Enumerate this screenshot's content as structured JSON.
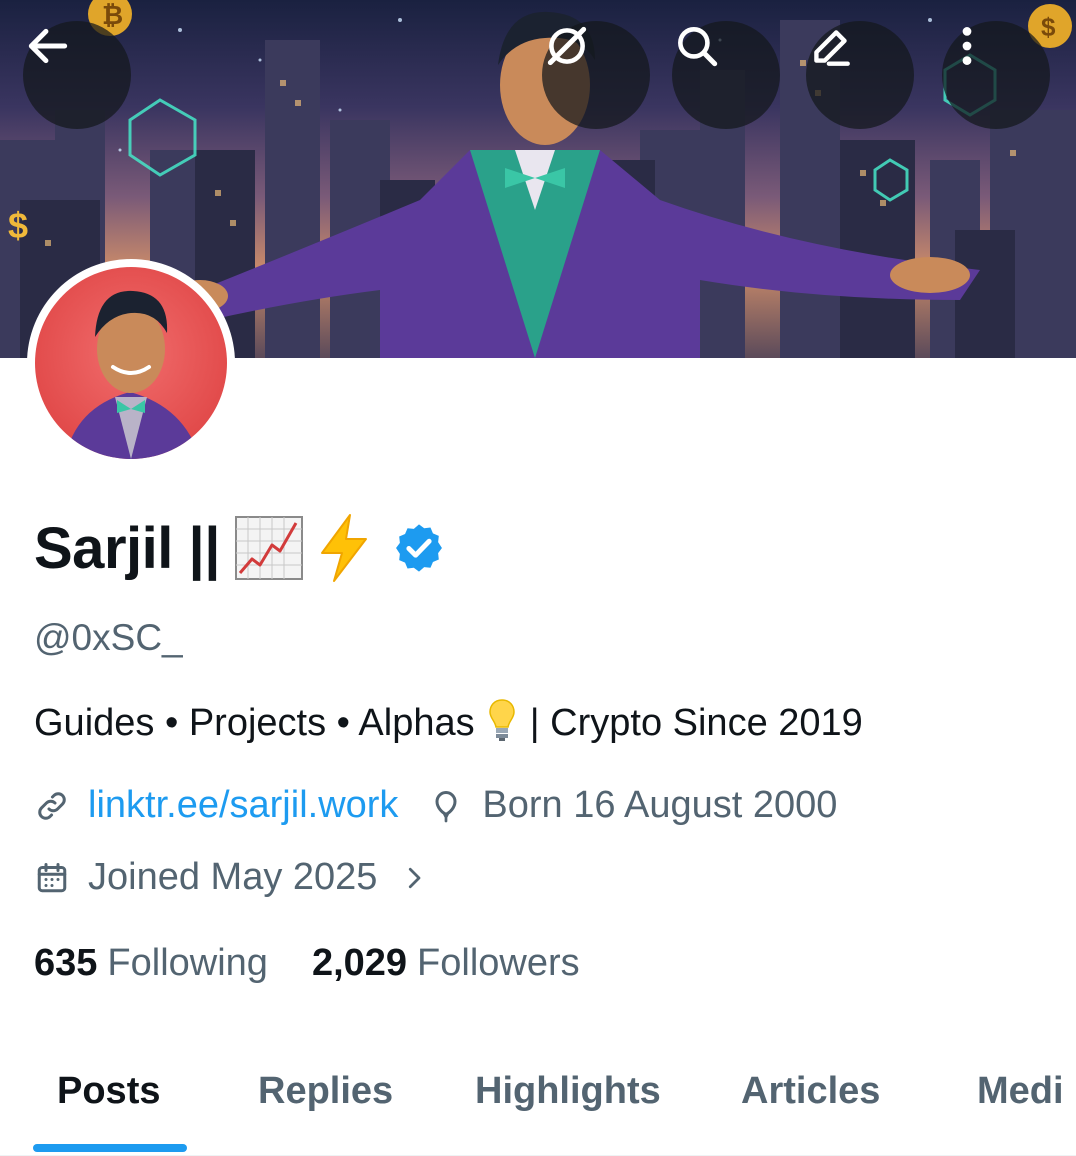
{
  "profile": {
    "display_name": "Sarjil ||",
    "handle": "@0xSC_",
    "bio_part1": "Guides • Projects • Alphas",
    "bio_part2": "| Crypto Since 2019",
    "website": "linktr.ee/sarjil.work",
    "birthday": "Born 16 August 2000",
    "joined": "Joined May 2025"
  },
  "stats": {
    "following_count": "635",
    "following_label": "Following",
    "followers_count": "2,029",
    "followers_label": "Followers"
  },
  "tabs": [
    {
      "label": "Posts",
      "active": true
    },
    {
      "label": "Replies",
      "active": false
    },
    {
      "label": "Highlights",
      "active": false
    },
    {
      "label": "Articles",
      "active": false
    },
    {
      "label": "Medi",
      "active": false
    }
  ],
  "colors": {
    "accent": "#1d9bf0",
    "text_primary": "#0f1419",
    "text_secondary": "#536471",
    "avatar_bg": "#e24b4b"
  },
  "icons": {
    "back": "arrow-left-icon",
    "grok": "grok-icon",
    "search": "search-icon",
    "edit": "edit-icon",
    "more": "more-vertical-icon",
    "verified": "verified-badge-icon",
    "link": "link-icon",
    "birthday": "balloon-icon",
    "joined": "calendar-icon"
  }
}
